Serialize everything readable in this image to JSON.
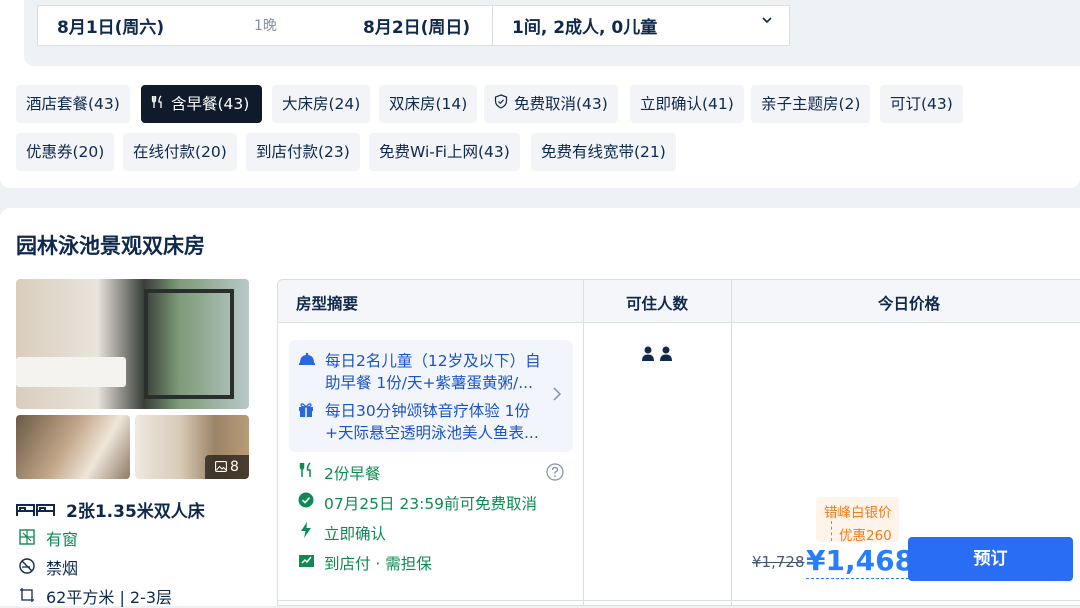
{
  "search": {
    "checkin": "8月1日(周六)",
    "nights": "1晚",
    "checkout": "8月2日(周日)",
    "guests": "1间, 2成人, 0儿童"
  },
  "filters": [
    {
      "label": "酒店套餐(43)",
      "active": false
    },
    {
      "label": "含早餐(43)",
      "active": true,
      "icon": "fork-knife-icon"
    },
    {
      "label": "大床房(24)",
      "active": false
    },
    {
      "label": "双床房(14)",
      "active": false
    },
    {
      "label": "免费取消(43)",
      "active": false,
      "icon": "shield-check-icon"
    },
    {
      "label": "立即确认(41)",
      "active": false
    },
    {
      "label": "亲子主题房(2)",
      "active": false
    },
    {
      "label": "可订(43)",
      "active": false
    },
    {
      "label": "优惠券(20)",
      "active": false
    },
    {
      "label": "在线付款(20)",
      "active": false
    },
    {
      "label": "到店付款(23)",
      "active": false
    },
    {
      "label": "免费Wi-Fi上网(43)",
      "active": false
    },
    {
      "label": "免费有线宽带(21)",
      "active": false
    }
  ],
  "room": {
    "title": "园林泳池景观双床房",
    "photo_count": "8",
    "features": {
      "bed": "2张1.35米双人床",
      "window": "有窗",
      "smoking": "禁烟",
      "size": "62平方米 | 2-3层"
    }
  },
  "table": {
    "headers": {
      "summary": "房型摘要",
      "capacity": "可住人数",
      "price": "今日价格"
    },
    "package": {
      "item1": "每日2名儿童（12岁及以下）自助早餐 1份/天+紫薯蛋黄粥/...",
      "item2": "每日30分钟颂钵音疗体验 1份+天际悬空透明泳池美人鱼表..."
    },
    "perks": {
      "breakfast": "2份早餐",
      "cancel": "07月25日 23:59前可免费取消",
      "confirm": "立即确认",
      "pay": "到店付 · 需担保"
    },
    "promo_line1": "错峰白银价",
    "promo_line2": "优惠260",
    "old_price": "¥1,728",
    "new_price": "¥1,468",
    "book_label": "预订"
  },
  "colors": {
    "accent": "#287dfa",
    "green": "#0f8a52",
    "orange": "#f07b1a",
    "dark": "#0f294d"
  }
}
